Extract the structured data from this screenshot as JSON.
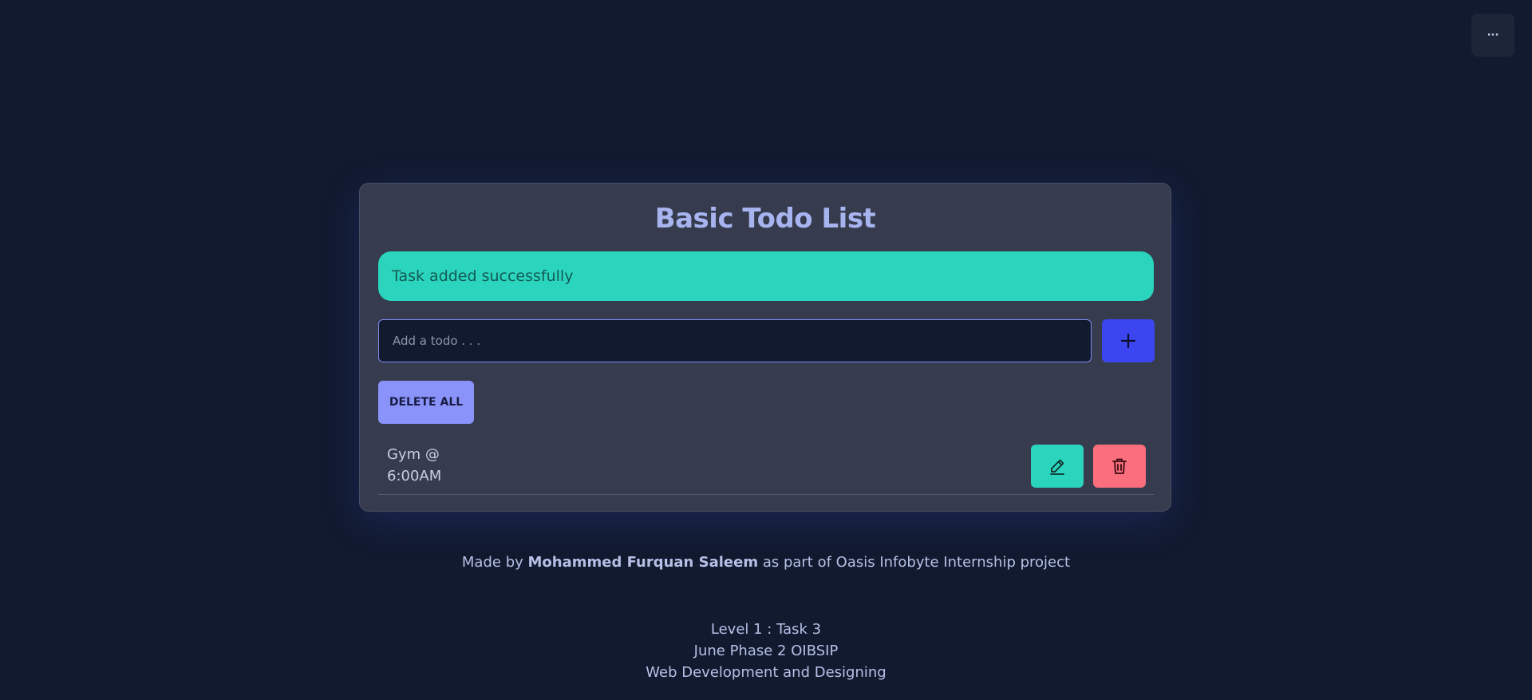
{
  "menu": {
    "label": "···",
    "icon": "more-dots-icon"
  },
  "app": {
    "title": "Basic Todo List"
  },
  "alert": {
    "message": "Task added successfully"
  },
  "input": {
    "placeholder": "Add a todo . . .",
    "value": ""
  },
  "add_button": {
    "icon": "plus-icon"
  },
  "delete_all_button": {
    "label": "DELETE ALL"
  },
  "todos": [
    {
      "text": "Gym @ 6:00AM",
      "edit_icon": "pencil-icon",
      "delete_icon": "trash-icon"
    }
  ],
  "footer": {
    "prefix": "Made by ",
    "author": "Mohammed Furquan Saleem",
    "suffix": " as part of Oasis Infobyte Internship project",
    "lines": [
      "Level 1 : Task 3",
      "June Phase 2 OIBSIP",
      "Web Development and Designing"
    ]
  },
  "colors": {
    "background": "#111a2e",
    "card": "#363c4e",
    "title": "#a7b4ef",
    "alert": "#2bd4bd",
    "add_button": "#3c46f0",
    "delete_all": "#8a93fa",
    "edit_button": "#2bd4bd",
    "delete_button": "#fb6e7d"
  }
}
